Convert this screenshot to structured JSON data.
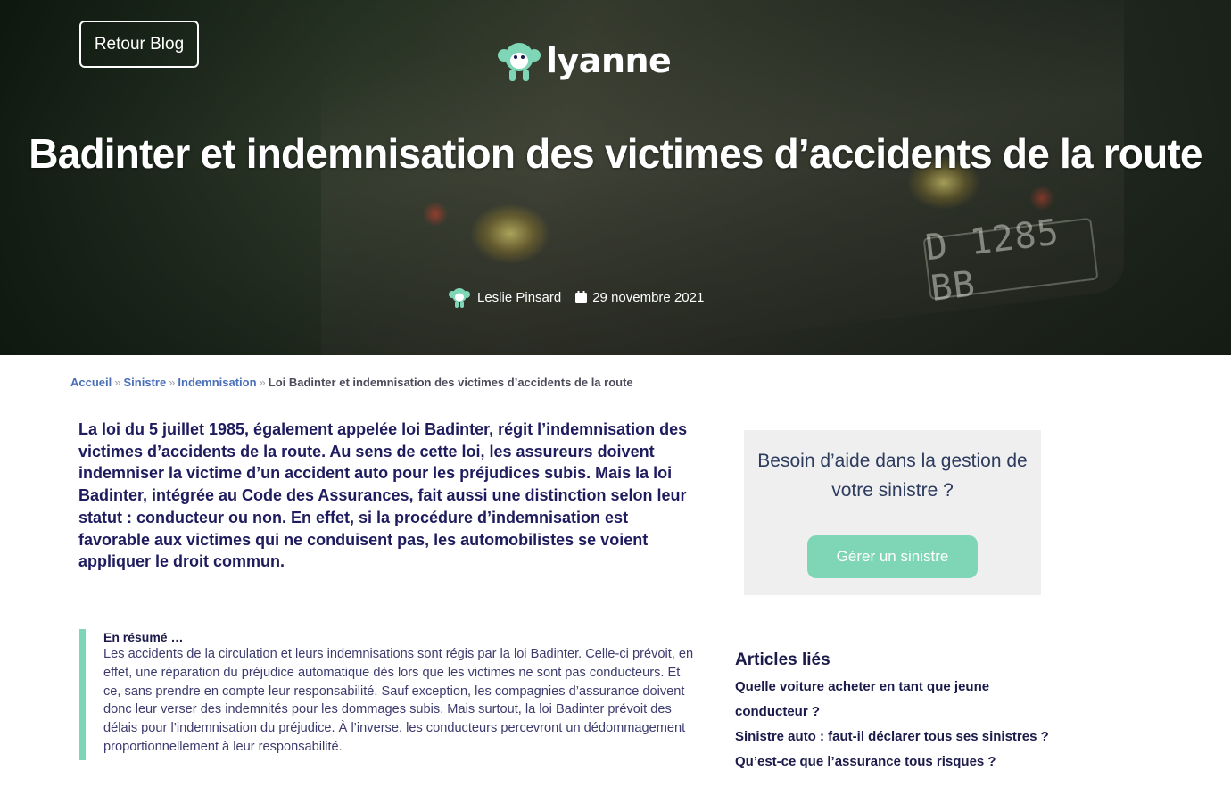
{
  "hero": {
    "back_button": "Retour Blog",
    "logo_text": "lyanne",
    "title": "Badinter et indemnisation des victimes d’accidents de la route",
    "author": "Leslie Pinsard",
    "date": "29 novembre 2021",
    "background_plate_text": "D 1285 BB"
  },
  "breadcrumb": {
    "items": [
      "Accueil",
      "Sinistre",
      "Indemnisation"
    ],
    "current": "Loi Badinter et indemnisation des victimes d’accidents de la route",
    "separator": "»"
  },
  "intro": {
    "text": "La loi du 5 juillet 1985, également appelée loi Badinter, régit l’indemnisation des victimes d’accidents de la route. Au sens de cette loi, les assureurs doivent indemniser la victime d’un accident auto pour les préjudices subis. Mais la loi Badinter, intégrée au Code des Assurances, fait aussi une distinction selon leur statut : conducteur ou non. En effet, si la procédure d’indemnisation est favorable aux victimes qui ne conduisent pas, les automobilistes se voient appliquer le droit commun."
  },
  "summary": {
    "title": "En résumé …",
    "text": "Les accidents de la circulation et leurs indemnisations sont régis par la loi Badinter. Celle-ci prévoit, en effet, une réparation du préjudice automatique dès lors que les victimes ne sont pas conducteurs. Et ce, sans prendre en compte leur responsabilité. Sauf exception, les compagnies d’assurance doivent donc leur verser des indemnités pour les dommages subis. Mais surtout, la loi Badinter prévoit des délais pour l’indemnisation du préjudice. À l’inverse, les conducteurs percevront un dédommagement proportionnellement à leur responsabilité."
  },
  "help_box": {
    "text": "Besoin d’aide dans la gestion de votre sinistre ?",
    "button": "Gérer un sinistre"
  },
  "related": {
    "title": "Articles liés",
    "items": [
      "Quelle voiture acheter en tant que jeune conducteur ?",
      "Sinistre auto : faut-il déclarer tous ses sinistres ?",
      "Qu’est-ce que l’assurance tous risques ?"
    ]
  },
  "colors": {
    "accent_mint": "#7fd6b6",
    "navy_text": "#1e1b5e",
    "breadcrumb_link": "#4a6fb6",
    "help_bg": "#efefef"
  },
  "icons": {
    "logo": "monkey-logo-icon",
    "author": "monkey-avatar-icon",
    "date": "calendar-icon"
  }
}
